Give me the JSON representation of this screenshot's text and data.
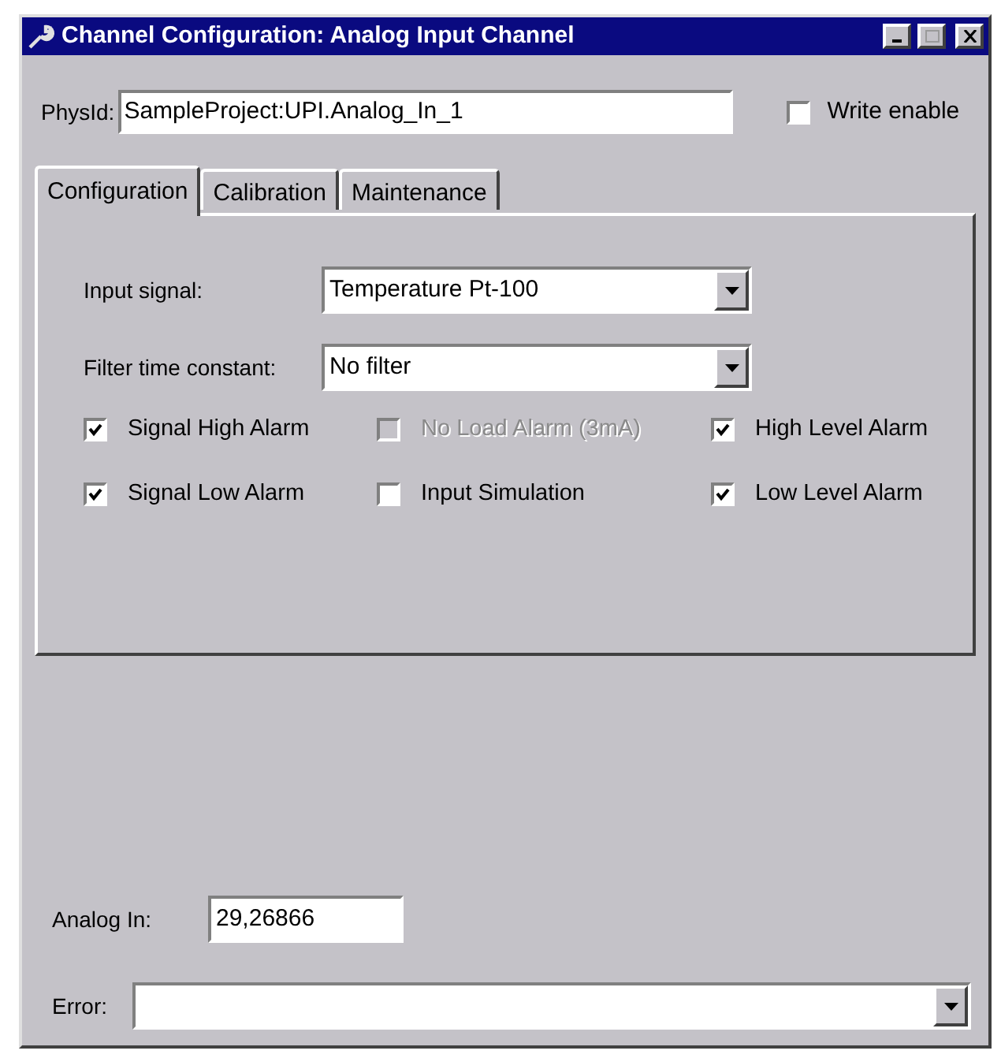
{
  "window": {
    "title": "Channel Configuration: Analog Input Channel"
  },
  "physid": {
    "label": "PhysId:",
    "value": "SampleProject:UPI.Analog_In_1"
  },
  "write_enable": {
    "label": "Write enable",
    "checked": false
  },
  "tabs": [
    {
      "label": "Configuration",
      "selected": true
    },
    {
      "label": "Calibration",
      "selected": false
    },
    {
      "label": "Maintenance",
      "selected": false
    }
  ],
  "input_signal": {
    "label": "Input signal:",
    "value": "Temperature Pt-100"
  },
  "filter_time_constant": {
    "label": "Filter time constant:",
    "value": "No filter"
  },
  "alarms": [
    {
      "label": "Signal High Alarm",
      "checked": true,
      "disabled": false
    },
    {
      "label": "No Load Alarm (3mA)",
      "checked": false,
      "disabled": true
    },
    {
      "label": "High Level Alarm",
      "checked": true,
      "disabled": false
    },
    {
      "label": "Signal Low Alarm",
      "checked": true,
      "disabled": false
    },
    {
      "label": "Input Simulation",
      "checked": false,
      "disabled": false
    },
    {
      "label": "Low Level Alarm",
      "checked": true,
      "disabled": false
    }
  ],
  "analog_in": {
    "label": "Analog In:",
    "value": "29,26866"
  },
  "error": {
    "label": "Error:"
  }
}
